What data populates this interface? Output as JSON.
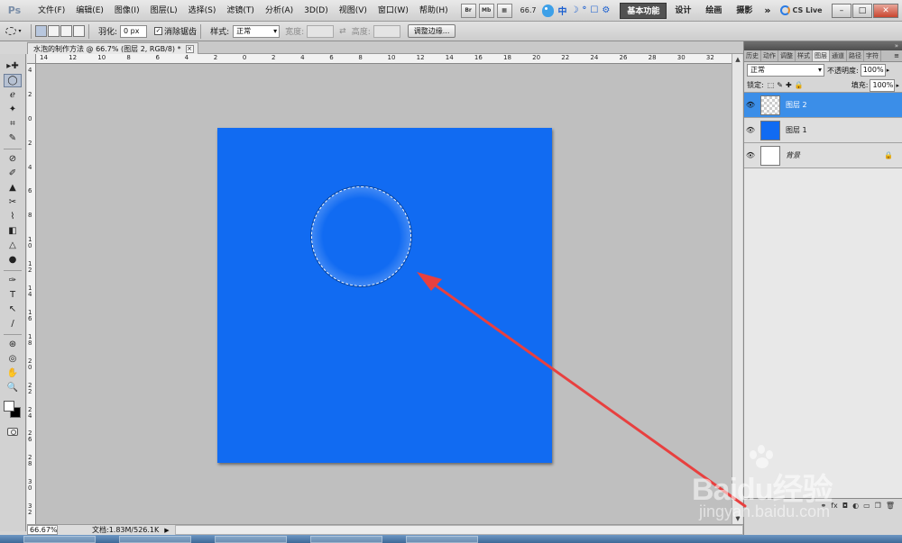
{
  "app": {
    "logo": "Ps"
  },
  "menu": {
    "items": [
      "文件(F)",
      "编辑(E)",
      "图像(I)",
      "图层(L)",
      "选择(S)",
      "滤镜(T)",
      "分析(A)",
      "3D(D)",
      "视图(V)",
      "窗口(W)",
      "帮助(H)"
    ],
    "bridge": "Br",
    "minibridge": "Mb",
    "zoom": "66.7",
    "ime_label": "中",
    "ime_symbols": [
      "☽",
      "°",
      "☐",
      "⚙"
    ],
    "workspaces": [
      "基本功能",
      "设计",
      "绘画",
      "摄影"
    ],
    "more": "»",
    "cs_live": "CS Live",
    "window_controls": [
      "–",
      "□",
      "✕"
    ]
  },
  "options": {
    "feather_label": "羽化:",
    "feather_value": "0 px",
    "antialias_label": "消除锯齿",
    "antialias_checked": "✓",
    "style_label": "样式:",
    "style_value": "正常",
    "width_label": "宽度:",
    "height_label": "高度:",
    "swap_icon": "⇄",
    "refine_edge": "调整边缘..."
  },
  "tools": [
    "▸✚",
    "◯",
    "ℯ",
    "✦",
    "⌗",
    "✎",
    "⊘",
    "✐",
    "▲",
    "✂",
    "⌇",
    "◧",
    "△",
    "●",
    "✑",
    "T",
    "↖",
    "/",
    "⊛",
    "◎",
    "✋",
    "🔍"
  ],
  "document": {
    "tab_title": "水泡的制作方法 @ 66.7% (图层 2, RGB/8) *",
    "tab_close": "×",
    "canvas_color": "#116bf2",
    "ruler_h_labels": [
      "14",
      "12",
      "10",
      "8",
      "6",
      "4",
      "2",
      "0",
      "2",
      "4",
      "6",
      "8",
      "10",
      "12",
      "14",
      "16",
      "18",
      "20",
      "22",
      "24",
      "26",
      "28",
      "30",
      "32"
    ],
    "ruler_v_labels": [
      "4",
      "2",
      "0",
      "2",
      "4",
      "6",
      "8",
      "1 0",
      "1 2",
      "1 4",
      "1 6",
      "1 8",
      "2 0",
      "2 2",
      "2 4",
      "2 6",
      "2 8",
      "3 0",
      "3 2"
    ]
  },
  "status": {
    "zoom": "66.67%",
    "doc_info": "文档:1.83M/526.1K",
    "arrow": "▶"
  },
  "panels": {
    "tabs": [
      "历史",
      "动作",
      "调整",
      "样式",
      "图层",
      "通道",
      "路径",
      "字符"
    ],
    "active_tab": "图层",
    "blend_mode": "正常",
    "opacity_label": "不透明度:",
    "opacity_value": "100%",
    "lock_label": "锁定:",
    "lock_icons": [
      "⬚",
      "✎",
      "✚",
      "🔒"
    ],
    "fill_label": "填充:",
    "fill_value": "100%",
    "layers": [
      {
        "name": "图层 2",
        "thumb": "transparent",
        "selected": true,
        "locked": false
      },
      {
        "name": "图层 1",
        "thumb": "blue",
        "selected": false,
        "locked": false
      },
      {
        "name": "背景",
        "thumb": "white",
        "selected": false,
        "locked": true
      }
    ],
    "eye_glyph": "👁",
    "lock_glyph": "🔒",
    "footer_icons": [
      "⚭",
      "fx",
      "◘",
      "◐",
      "▭",
      "❐",
      "🗑"
    ]
  },
  "watermark": {
    "main_prefix": "Bai",
    "main_suffix": "du",
    "main_tail": "经验",
    "sub": "jingyan.baidu.com"
  },
  "colors": {
    "annotation_arrow": "#e8403f",
    "selected_layer": "#3b8ee8"
  }
}
